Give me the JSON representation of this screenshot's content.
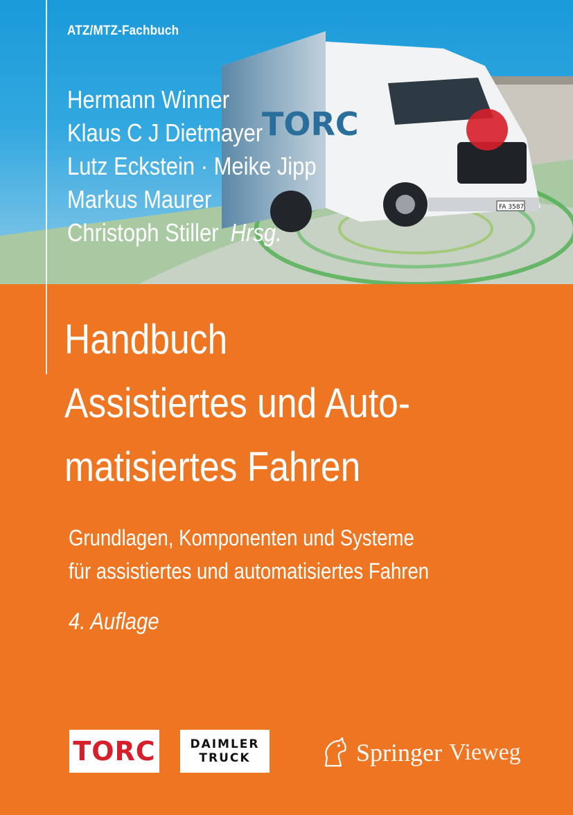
{
  "cover": {
    "series": "ATZ/MTZ-Fachbuch",
    "authors": [
      "Hermann Winner",
      "Klaus C J Dietmayer",
      "Lutz Eckstein · Meike Jipp",
      "Markus Maurer",
      "Christoph Stiller"
    ],
    "editor_suffix": "Hrsg.",
    "title_lines": [
      "Handbuch",
      "Assistiertes und Auto-",
      "matisiertes Fahren"
    ],
    "subtitle_lines": [
      "Grundlagen, Komponenten und Systeme",
      "für assistiertes und automatisiertes Fahren"
    ],
    "edition": "4. Auflage",
    "truck_logo_text": "TORC",
    "truck_plate": "FA 3587"
  },
  "logos": {
    "torc": "TORC",
    "daimler_line1": "DAIMLER",
    "daimler_line2": "TRUCK",
    "springer": "Springer",
    "vieweg": "Vieweg"
  },
  "colors": {
    "orange": "#ee7623",
    "sky_blue": "#1a9ad9",
    "torc_red": "#d61f2a"
  }
}
